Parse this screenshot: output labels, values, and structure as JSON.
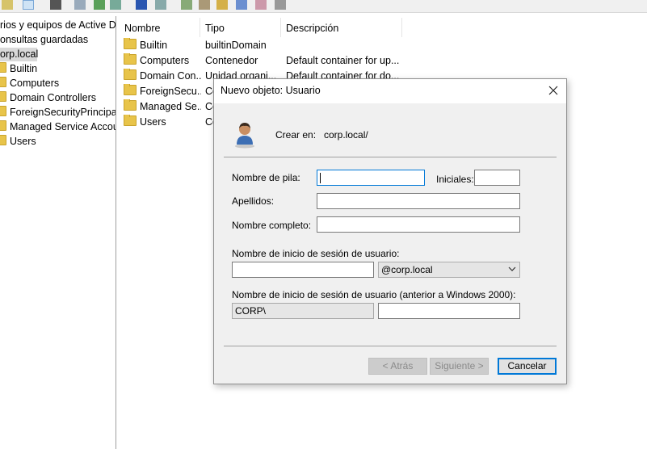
{
  "tree": {
    "root_label": "rios y equipos de Active Dir",
    "saved_queries": "onsultas guardadas",
    "domain": "orp.local",
    "children": [
      "Builtin",
      "Computers",
      "Domain Controllers",
      "ForeignSecurityPrincipals",
      "Managed Service Accoun",
      "Users"
    ]
  },
  "list": {
    "headers": {
      "name": "Nombre",
      "type": "Tipo",
      "description": "Descripción"
    },
    "rows": [
      {
        "name": "Builtin",
        "type": "builtinDomain",
        "description": ""
      },
      {
        "name": "Computers",
        "type": "Contenedor",
        "description": "Default container for up..."
      },
      {
        "name": "Domain Con...",
        "type": "Unidad organi...",
        "description": "Default container for do..."
      },
      {
        "name": "ForeignSecu...",
        "type": "Co",
        "description": ""
      },
      {
        "name": "Managed Se...",
        "type": "Co",
        "description": ""
      },
      {
        "name": "Users",
        "type": "Co",
        "description": ""
      }
    ]
  },
  "dialog": {
    "title": "Nuevo objeto: Usuario",
    "create_in_label": "Crear en:",
    "create_in_value": "corp.local/",
    "first_name_label": "Nombre de pila:",
    "first_name_value": "",
    "initials_label": "Iniciales:",
    "initials_value": "",
    "last_name_label": "Apellidos:",
    "last_name_value": "",
    "full_name_label": "Nombre completo:",
    "full_name_value": "",
    "logon_label": "Nombre de inicio de sesión de usuario:",
    "logon_value": "",
    "domain_suffix": "@corp.local",
    "logon_pre2000_label": "Nombre de inicio de sesión de usuario (anterior a Windows 2000):",
    "netbios_prefix": "CORP\\",
    "pre2000_value": "",
    "back_button": "< Atrás",
    "next_button": "Siguiente >",
    "cancel_button": "Cancelar"
  },
  "icons": [
    "folder-icon",
    "user-icon",
    "close-icon",
    "chevron-down-icon"
  ],
  "colors": {
    "focus_accent": "#0078d7",
    "folder": "#e8c44a",
    "dialog_bg": "#f0f0f0"
  }
}
